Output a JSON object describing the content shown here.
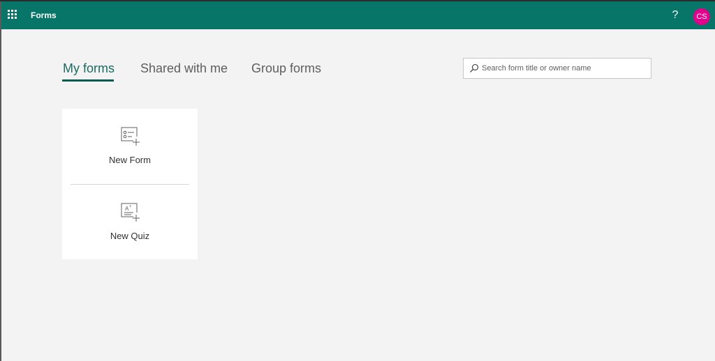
{
  "header": {
    "app_name": "Forms",
    "help_label": "?",
    "avatar_initials": "CS",
    "bar_color": "#077568",
    "avatar_color": "#e3008c"
  },
  "tabs": [
    {
      "label": "My forms",
      "active": true
    },
    {
      "label": "Shared with me",
      "active": false
    },
    {
      "label": "Group forms",
      "active": false
    }
  ],
  "search": {
    "placeholder": "Search form title or owner name",
    "value": ""
  },
  "new_items": {
    "new_form_label": "New Form",
    "new_quiz_label": "New Quiz",
    "new_form_icon": "new-form-icon",
    "new_quiz_icon": "new-quiz-icon"
  }
}
